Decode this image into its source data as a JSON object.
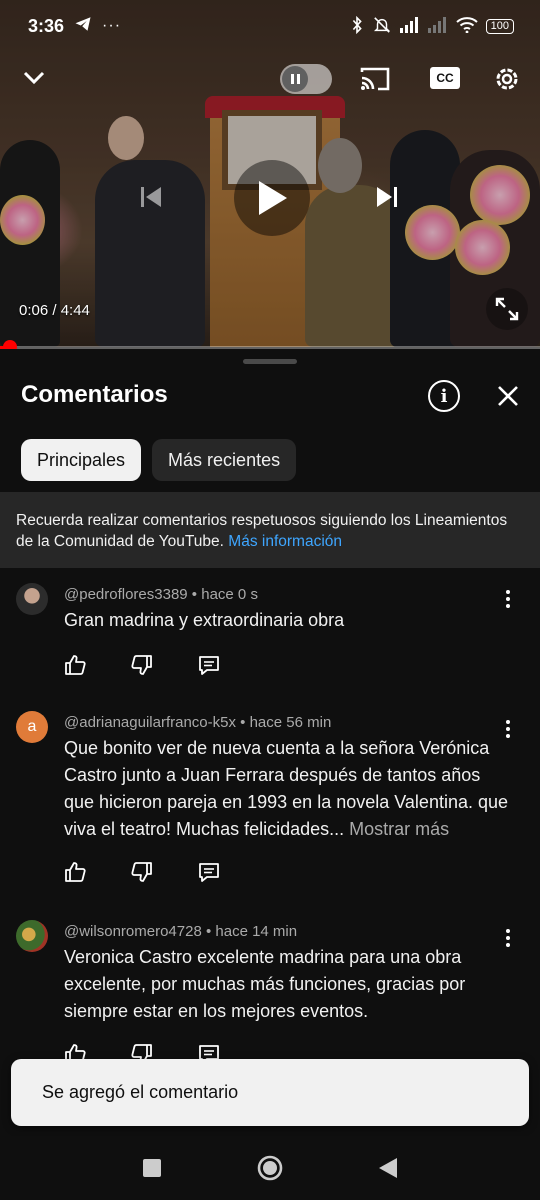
{
  "status": {
    "time": "3:36",
    "battery": "100",
    "icons": [
      "telegram-icon",
      "more-dots-icon",
      "bluetooth-icon",
      "mute-icon",
      "signal-icon",
      "signal-icon",
      "wifi-icon",
      "battery-icon"
    ],
    "more": "···"
  },
  "player": {
    "timecode": "0:06 / 4:44",
    "progress_fraction": 0.022,
    "cc_label": "CC",
    "accent": "#ff0000"
  },
  "panel": {
    "title": "Comentarios",
    "chips": [
      {
        "label": "Principales",
        "active": true
      },
      {
        "label": "Más recientes",
        "active": false
      }
    ],
    "notice": {
      "text": "Recuerda realizar comentarios respetuosos siguiendo los Lineamientos de la Comunidad de YouTube.",
      "link": "Más información",
      "link_color": "#3ea6ff"
    }
  },
  "comments": [
    {
      "author": "@pedroflores3389",
      "time": "hace 0 s",
      "text": "Gran madrina y extraordinaria obra",
      "more": ""
    },
    {
      "author": "@adrianaguilarfranco-k5x",
      "time": "hace 56 min",
      "avatar_letter": "a",
      "text": "Que bonito ver de nueva cuenta a la señora Verónica Castro junto a Juan Ferrara después de tantos años que hicieron pareja en 1993 en la novela Valentina. que viva el teatro! Muchas felicidades...",
      "more": "Mostrar más"
    },
    {
      "author": "@wilsonromero4728",
      "time": "hace 14 min",
      "text": "Veronica Castro excelente madrina para una obra excelente, por muchas más funciones, gracias por siempre estar en los mejores eventos.",
      "more": ""
    }
  ],
  "toast": {
    "text": "Se agregó el comentario"
  }
}
